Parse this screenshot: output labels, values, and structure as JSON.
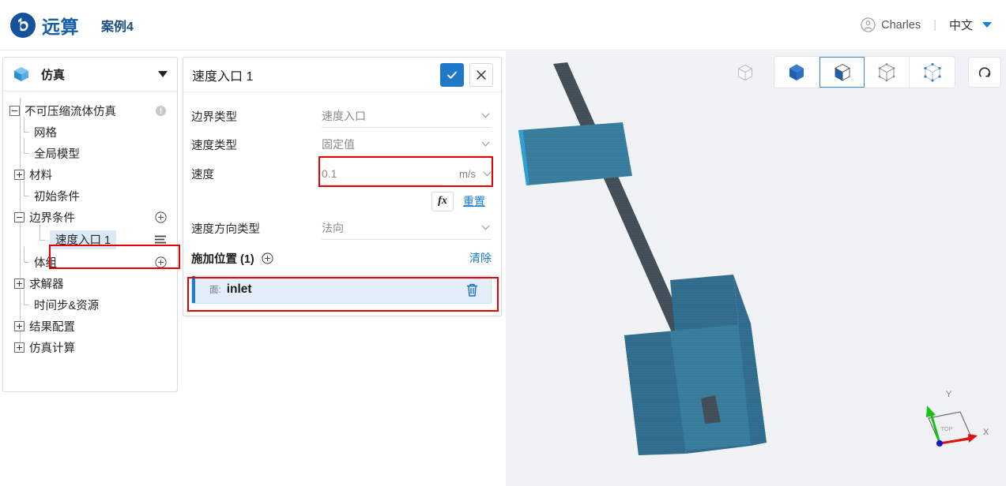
{
  "app": {
    "logo_text": "远算",
    "case_title": "案例4",
    "user_name": "Charles",
    "divider": "|",
    "language": "中文"
  },
  "sidebar": {
    "header": {
      "label": "仿真",
      "icon": "cube-icon",
      "caret": "chevron-down-icon"
    },
    "nodes": [
      {
        "label": "不可压缩流体仿真",
        "toggle": "minus",
        "level": 0,
        "right": "warning-icon"
      },
      {
        "label": "网格",
        "toggle": "none",
        "level": 1,
        "right": ""
      },
      {
        "label": "全局模型",
        "toggle": "none",
        "level": 1,
        "right": ""
      },
      {
        "label": "材料",
        "toggle": "plus",
        "level": 1,
        "right": ""
      },
      {
        "label": "初始条件",
        "toggle": "none",
        "level": 1,
        "right": ""
      },
      {
        "label": "边界条件",
        "toggle": "minus",
        "level": 1,
        "right": "plus-circle-icon"
      },
      {
        "label": "速度入口 1",
        "toggle": "none",
        "level": 2,
        "right": "hamburger-icon",
        "selected": true
      },
      {
        "label": "体组",
        "toggle": "none",
        "level": 1,
        "right": "plus-circle-icon"
      },
      {
        "label": "求解器",
        "toggle": "plus",
        "level": 1,
        "right": ""
      },
      {
        "label": "时间步&资源",
        "toggle": "none",
        "level": 1,
        "right": ""
      },
      {
        "label": "结果配置",
        "toggle": "plus",
        "level": 1,
        "right": ""
      },
      {
        "label": "仿真计算",
        "toggle": "plus",
        "level": 1,
        "right": ""
      }
    ]
  },
  "panel": {
    "title": "速度入口 1",
    "confirm_label": "✓",
    "cancel_label": "✕",
    "fields": [
      {
        "label": "边界类型",
        "value": "速度入口",
        "unit": "",
        "control": "select"
      },
      {
        "label": "速度类型",
        "value": "固定值",
        "unit": "",
        "control": "select"
      },
      {
        "label": "速度",
        "value": "0.1",
        "unit": "m/s",
        "control": "input-unit",
        "highlighted": true
      },
      {
        "label": "速度方向类型",
        "value": "法向",
        "unit": "",
        "control": "select"
      }
    ],
    "fx_label": "fx",
    "reset_label": "重置",
    "apply": {
      "title": "施加位置 (1)",
      "add_icon": "plus-circle-icon",
      "clear_label": "清除",
      "item": {
        "type_label": "面:",
        "name": "inlet",
        "delete_icon": "trash-icon"
      }
    }
  },
  "viewport": {
    "toolbar": [
      {
        "name": "wireframe-cube-icon",
        "active": false,
        "grouped": false
      },
      {
        "name": "solid-cube-icon",
        "active": false,
        "grouped": true
      },
      {
        "name": "solid-edges-cube-icon",
        "active": true,
        "grouped": true
      },
      {
        "name": "outline-cube-icon",
        "active": false,
        "grouped": true
      },
      {
        "name": "points-cube-icon",
        "active": false,
        "grouped": true
      },
      {
        "name": "reset-view-icon",
        "active": false,
        "grouped": false
      }
    ],
    "gizmo": {
      "x_label": "X",
      "y_label": "Y",
      "face_label": "TOP"
    }
  },
  "colors": {
    "brand_blue": "#1560a8",
    "accent_blue": "#1a7bd4",
    "confirm_blue": "#2079c8",
    "highlight_red": "#e60000",
    "mesh_blue": "#3a7ea4",
    "mesh_dark": "#3c4f5a"
  }
}
